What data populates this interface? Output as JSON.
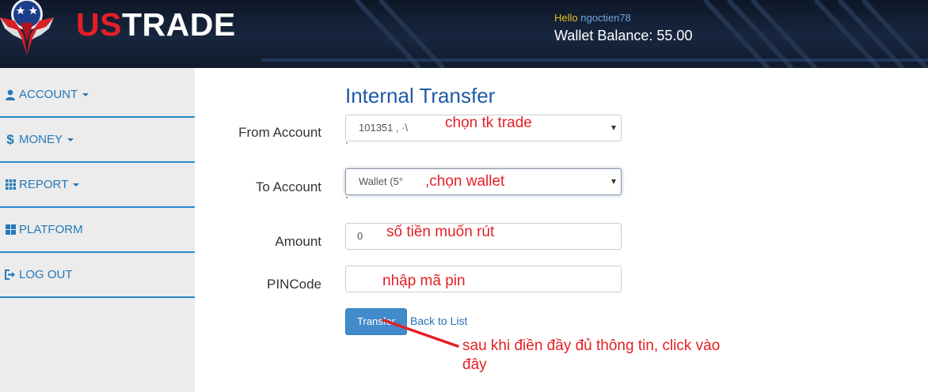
{
  "header": {
    "logo_us": "US",
    "logo_trade": "TRADE",
    "hello_label": "Hello",
    "username": "ngoctien78",
    "wallet_label": "Wallet Balance: ",
    "wallet_value": "55.00"
  },
  "sidebar": {
    "items": [
      {
        "label": "ACCOUNT",
        "icon": "user-icon",
        "dropdown": true
      },
      {
        "label": "MONEY",
        "icon": "dollar-icon",
        "dropdown": true
      },
      {
        "label": "REPORT",
        "icon": "grid-icon",
        "dropdown": true
      },
      {
        "label": "PLATFORM",
        "icon": "windows-icon",
        "dropdown": false
      },
      {
        "label": "LOG OUT",
        "icon": "logout-icon",
        "dropdown": false
      }
    ]
  },
  "form": {
    "title": "Internal Transfer",
    "from_label": "From Account",
    "from_value": "101351 ,        ·\\",
    "to_label": "To Account",
    "to_value": "Wallet (5°",
    "amount_label": "Amount",
    "amount_value": "0",
    "pin_label": "PINCode",
    "pin_value": "",
    "tick": "`",
    "submit_label": "Transfer",
    "back_label": "Back to List"
  },
  "annotations": {
    "from": "chọn tk trade",
    "to": ",chọn wallet",
    "amount": "số tiền muốn rút",
    "pin": "nhập mã pin",
    "submit_line1": "sau khi điền đầy đủ thông tin, click vào",
    "submit_line2": "đây"
  },
  "colors": {
    "brand_red": "#e41f26",
    "link_blue": "#2479b8",
    "button_blue": "#428bca",
    "header_bg": "#101a2c"
  }
}
